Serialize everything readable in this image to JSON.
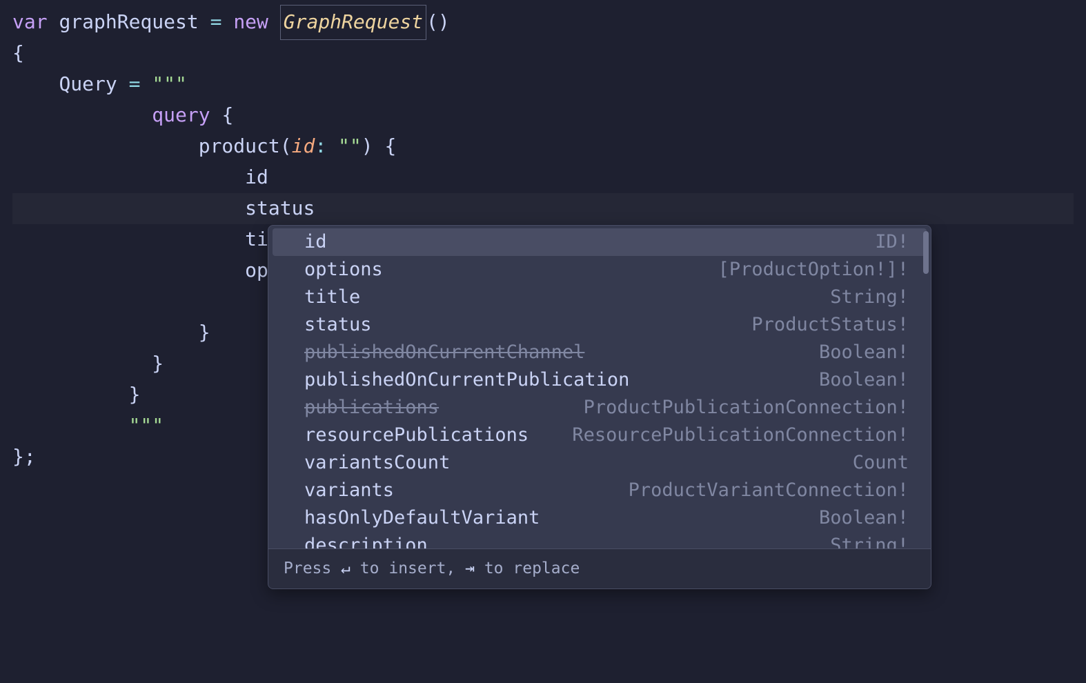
{
  "code": {
    "line1": {
      "var": "var",
      "ident": "graphRequest",
      "eq": "=",
      "new": "new",
      "type": "GraphRequest",
      "parens": "()"
    },
    "line2": "{",
    "line3": {
      "indent": "    ",
      "prop": "Query",
      "eq": "=",
      "quotes": "\"\"\""
    },
    "line4": {
      "indent": "            ",
      "keyword": "query",
      "brace": " {"
    },
    "line5": {
      "indent": "                ",
      "func": "product",
      "open": "(",
      "param": "id",
      "colon": ":",
      "str": " \"\"",
      "close": ") {"
    },
    "line6": {
      "indent": "                    ",
      "field": "id"
    },
    "line7": {
      "indent": "                    ",
      "field": "status"
    },
    "line8": {
      "indent": "                    ",
      "field": "titl"
    },
    "line9": {
      "indent": "                    ",
      "field": "opti"
    },
    "line10": {
      "indent": "                    ",
      "field": ""
    },
    "line11": {
      "indent": "                ",
      "brace": "}"
    },
    "line12": {
      "indent": "            ",
      "brace": "}"
    },
    "line13": {
      "indent": "          ",
      "brace": "}"
    },
    "line14": {
      "indent": "          ",
      "quotes": "\"\"\""
    },
    "line15": "};"
  },
  "autocomplete": {
    "items": [
      {
        "name": "id",
        "type": "ID!",
        "deprecated": false,
        "selected": true
      },
      {
        "name": "options",
        "type": "[ProductOption!]!",
        "deprecated": false,
        "selected": false
      },
      {
        "name": "title",
        "type": "String!",
        "deprecated": false,
        "selected": false
      },
      {
        "name": "status",
        "type": "ProductStatus!",
        "deprecated": false,
        "selected": false
      },
      {
        "name": "publishedOnCurrentChannel",
        "type": "Boolean!",
        "deprecated": true,
        "selected": false
      },
      {
        "name": "publishedOnCurrentPublication",
        "type": "Boolean!",
        "deprecated": false,
        "selected": false
      },
      {
        "name": "publications",
        "type": "ProductPublicationConnection!",
        "deprecated": true,
        "selected": false
      },
      {
        "name": "resourcePublications",
        "type": "ResourcePublicationConnection!",
        "deprecated": false,
        "selected": false
      },
      {
        "name": "variantsCount",
        "type": "Count",
        "deprecated": false,
        "selected": false
      },
      {
        "name": "variants",
        "type": "ProductVariantConnection!",
        "deprecated": false,
        "selected": false
      },
      {
        "name": "hasOnlyDefaultVariant",
        "type": "Boolean!",
        "deprecated": false,
        "selected": false
      },
      {
        "name": "description",
        "type": "String!",
        "deprecated": false,
        "selected": false
      }
    ],
    "footer": {
      "prefix": "Press ",
      "key1": "↵",
      "mid1": " to insert, ",
      "key2": "⇥",
      "mid2": " to replace"
    }
  }
}
